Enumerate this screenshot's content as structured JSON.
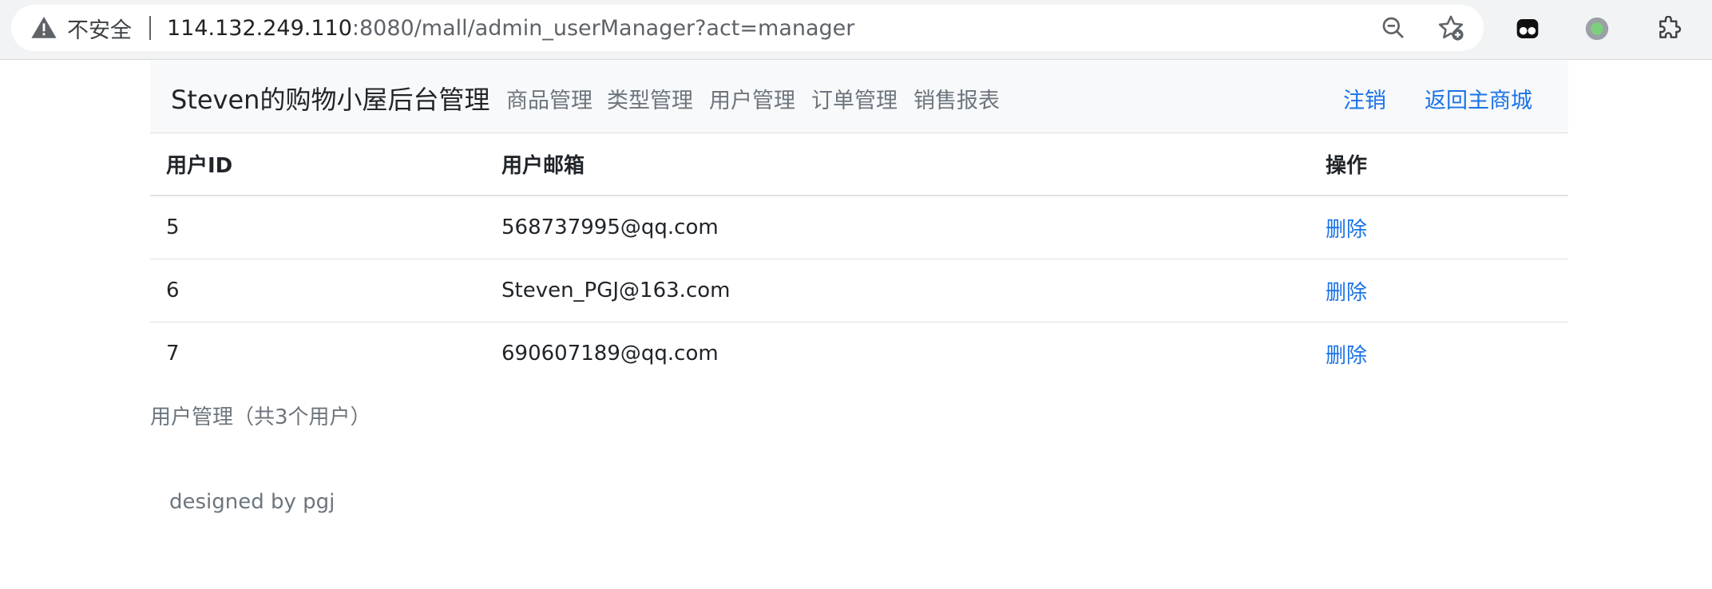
{
  "browser": {
    "security_label": "不安全",
    "url_host": "114.132.249.110",
    "url_rest": ":8080/mall/admin_userManager?act=manager",
    "icons": [
      "warning-icon",
      "zoom-out-icon",
      "bookmark-star-icon",
      "extension-mask-icon",
      "extension-green-dot-icon",
      "extensions-puzzle-icon"
    ]
  },
  "navbar": {
    "brand": "Steven的购物小屋后台管理",
    "links": [
      "商品管理",
      "类型管理",
      "用户管理",
      "订单管理",
      "销售报表"
    ],
    "logout": "注销",
    "back_to_mall": "返回主商城"
  },
  "table": {
    "headers": [
      "用户ID",
      "用户邮箱",
      "操作"
    ],
    "rows": [
      {
        "id": "5",
        "email": "568737995@qq.com",
        "action": "删除"
      },
      {
        "id": "6",
        "email": "Steven_PGJ@163.com",
        "action": "删除"
      },
      {
        "id": "7",
        "email": "690607189@qq.com",
        "action": "删除"
      }
    ]
  },
  "caption": "用户管理（共3个用户）",
  "footer": "designed by pgj",
  "colors": {
    "link": "#1a73e8",
    "muted": "#6c757d",
    "navbar_bg": "#f8f9fa"
  }
}
